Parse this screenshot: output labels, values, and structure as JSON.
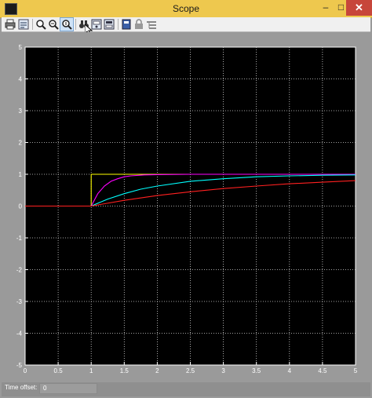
{
  "window": {
    "title": "Scope",
    "close_label": "✕",
    "min_label": "–",
    "max_label": "□"
  },
  "toolbar": {
    "icons": [
      "print-icon",
      "parameters-icon",
      "zoom-icon",
      "zoom-x-icon",
      "zoom-y-icon",
      "autoscale-icon",
      "save-axes-icon",
      "restore-axes-icon",
      "floating-scope-icon",
      "lock-axes-icon",
      "signal-selection-icon"
    ]
  },
  "status": {
    "time_offset_label": "Time offset:",
    "time_offset_value": "0"
  },
  "colors": {
    "plot_bg": "#000000",
    "frame_bg": "#9a9a9a",
    "axis": "#ffffff",
    "grid": "#d8d8d8",
    "series": [
      "#ffff00",
      "#ff00ff",
      "#00ffff",
      "#ff2020"
    ]
  },
  "chart_data": {
    "type": "line",
    "title": "",
    "xlabel": "",
    "ylabel": "",
    "xlim": [
      0,
      5
    ],
    "ylim": [
      -5,
      5
    ],
    "xticks": [
      "0",
      "0.5",
      "1",
      "1.5",
      "2",
      "2.5",
      "3",
      "3.5",
      "4",
      "4.5",
      "5"
    ],
    "yticks": [
      "-5",
      "-4",
      "-3",
      "-2",
      "-1",
      "0",
      "1",
      "2",
      "3",
      "4",
      "5"
    ],
    "grid": true,
    "legend": "none",
    "series": [
      {
        "color": "#ffff00",
        "x": [
          0,
          1,
          1,
          5
        ],
        "y": [
          0,
          0,
          1,
          1
        ]
      },
      {
        "color": "#ff00ff",
        "x": [
          0,
          1,
          1.1,
          1.2,
          1.3,
          1.4,
          1.5,
          1.6,
          1.8,
          2.0,
          2.5,
          3,
          5
        ],
        "y": [
          0,
          0,
          0.39,
          0.63,
          0.78,
          0.86,
          0.92,
          0.95,
          0.98,
          0.99,
          1.0,
          1.0,
          1.0
        ]
      },
      {
        "color": "#00ffff",
        "x": [
          0,
          1,
          1.25,
          1.5,
          1.75,
          2.0,
          2.5,
          3,
          3.5,
          4,
          4.5,
          5
        ],
        "y": [
          0,
          0,
          0.22,
          0.39,
          0.53,
          0.63,
          0.78,
          0.86,
          0.92,
          0.95,
          0.97,
          0.98
        ]
      },
      {
        "color": "#ff2020",
        "x": [
          0,
          1,
          1.5,
          2.0,
          2.5,
          3,
          3.5,
          4,
          4.5,
          5
        ],
        "y": [
          0,
          0,
          0.18,
          0.33,
          0.45,
          0.55,
          0.63,
          0.7,
          0.75,
          0.8
        ]
      }
    ]
  }
}
